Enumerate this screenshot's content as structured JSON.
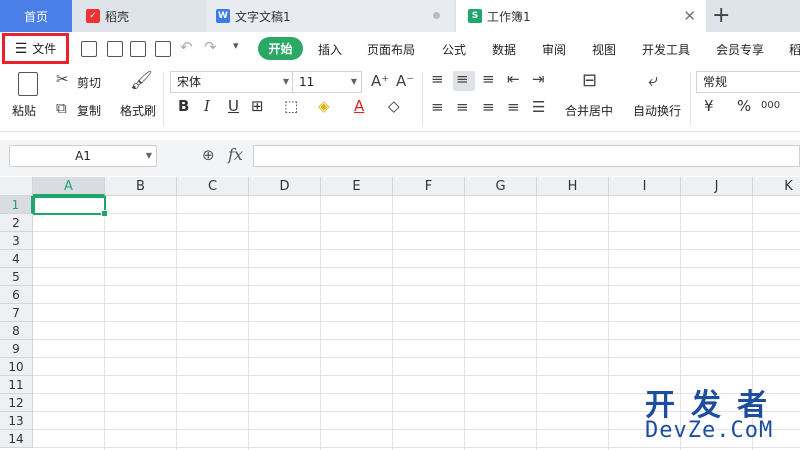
{
  "tabs": {
    "home": "首页",
    "daoke": "稻壳",
    "doc": "文字文稿1",
    "sheet": "工作簿1"
  },
  "menu": {
    "file": "文件",
    "active": "开始",
    "items": [
      "插入",
      "页面布局",
      "公式",
      "数据",
      "审阅",
      "视图",
      "开发工具",
      "会员专享",
      "稻"
    ]
  },
  "ribbon": {
    "paste": "粘贴",
    "cut": "剪切",
    "copy": "复制",
    "format_painter": "格式刷",
    "font_name": "宋体",
    "font_size": "11",
    "merge_center": "合并居中",
    "wrap_text": "自动换行",
    "number_format": "常规",
    "currency": "¥",
    "percent": "%",
    "thousands": "000"
  },
  "formula_bar": {
    "cell_ref": "A1",
    "fx": "fx",
    "formula": ""
  },
  "sheet": {
    "columns": [
      "A",
      "B",
      "C",
      "D",
      "E",
      "F",
      "G",
      "H",
      "I",
      "J",
      "K"
    ],
    "rows": [
      "1",
      "2",
      "3",
      "4",
      "5",
      "6",
      "7",
      "8",
      "9",
      "10",
      "11",
      "12",
      "13",
      "14"
    ],
    "active_col": "A",
    "active_row": "1"
  },
  "watermark": {
    "top": "开发者",
    "bottom": "DevZe.CoM"
  },
  "colors": {
    "accent_green": "#2ba866",
    "home_tab_blue": "#4a7fe8",
    "highlight_red": "#e8222b"
  }
}
